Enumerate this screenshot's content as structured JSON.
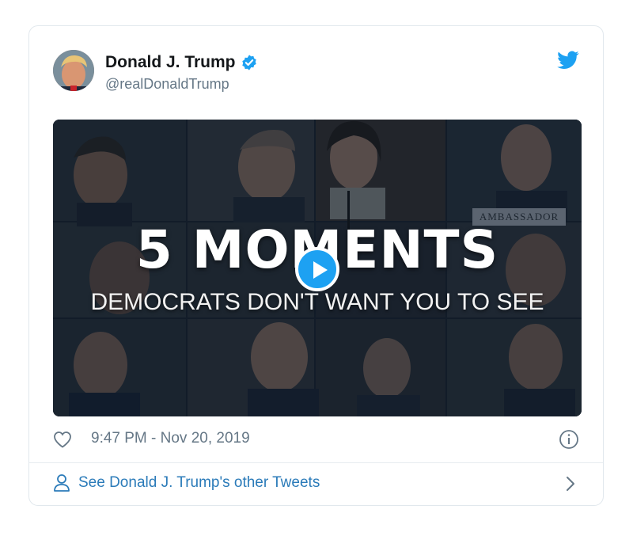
{
  "tweet": {
    "display_name": "Donald J. Trump",
    "handle": "@realDonaldTrump",
    "timestamp": "9:47 PM - Nov 20, 2019"
  },
  "media": {
    "headline": "5 MOMENTS",
    "subline": "DEMOCRATS DON'T WANT YOU TO SEE",
    "ambassador_label": "AMBASSADOR"
  },
  "footer": {
    "link_label": "See Donald J. Trump's other Tweets"
  },
  "icons": {
    "verified": "verified-badge-icon",
    "bird": "twitter-bird-icon",
    "play": "play-icon",
    "heart": "heart-icon",
    "info": "info-icon",
    "person": "person-icon",
    "chevron": "chevron-right-icon"
  },
  "colors": {
    "brand_blue": "#1da1f2",
    "link_blue": "#2b7bb9",
    "muted_text": "#657786",
    "name_text": "#14171a"
  }
}
